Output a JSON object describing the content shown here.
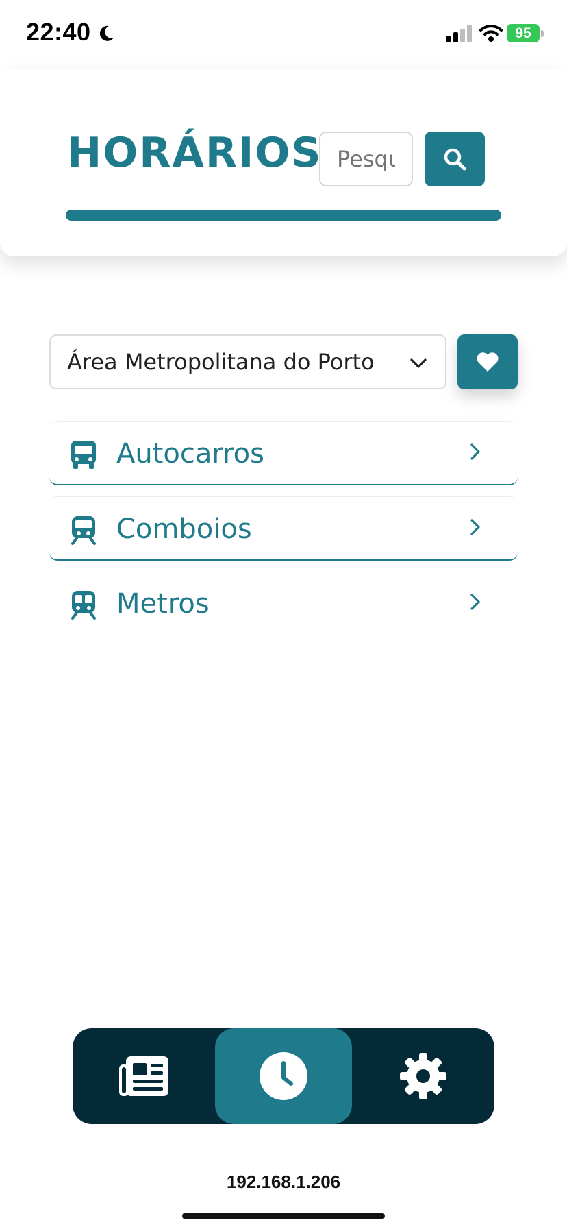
{
  "status_bar": {
    "time": "22:40",
    "battery": "95",
    "battery_color": "#35c759"
  },
  "header": {
    "title": "HORÁRIOS",
    "search_placeholder": "Pesquisar",
    "search_icon": "search-icon",
    "accent_color": "#1f7a8c"
  },
  "region": {
    "selected": "Área Metropolitana do Porto",
    "favorite_icon": "heart-icon"
  },
  "transport": {
    "items": [
      {
        "label": "Autocarros",
        "icon": "bus-icon"
      },
      {
        "label": "Comboios",
        "icon": "train-icon"
      },
      {
        "label": "Metros",
        "icon": "subway-icon"
      }
    ]
  },
  "bottom_nav": {
    "items": [
      {
        "name": "news",
        "icon": "newspaper-icon",
        "active": false
      },
      {
        "name": "schedule",
        "icon": "clock-icon",
        "active": true
      },
      {
        "name": "settings",
        "icon": "gear-icon",
        "active": false
      }
    ],
    "background": "#042a38"
  },
  "browser": {
    "url": "192.168.1.206"
  }
}
